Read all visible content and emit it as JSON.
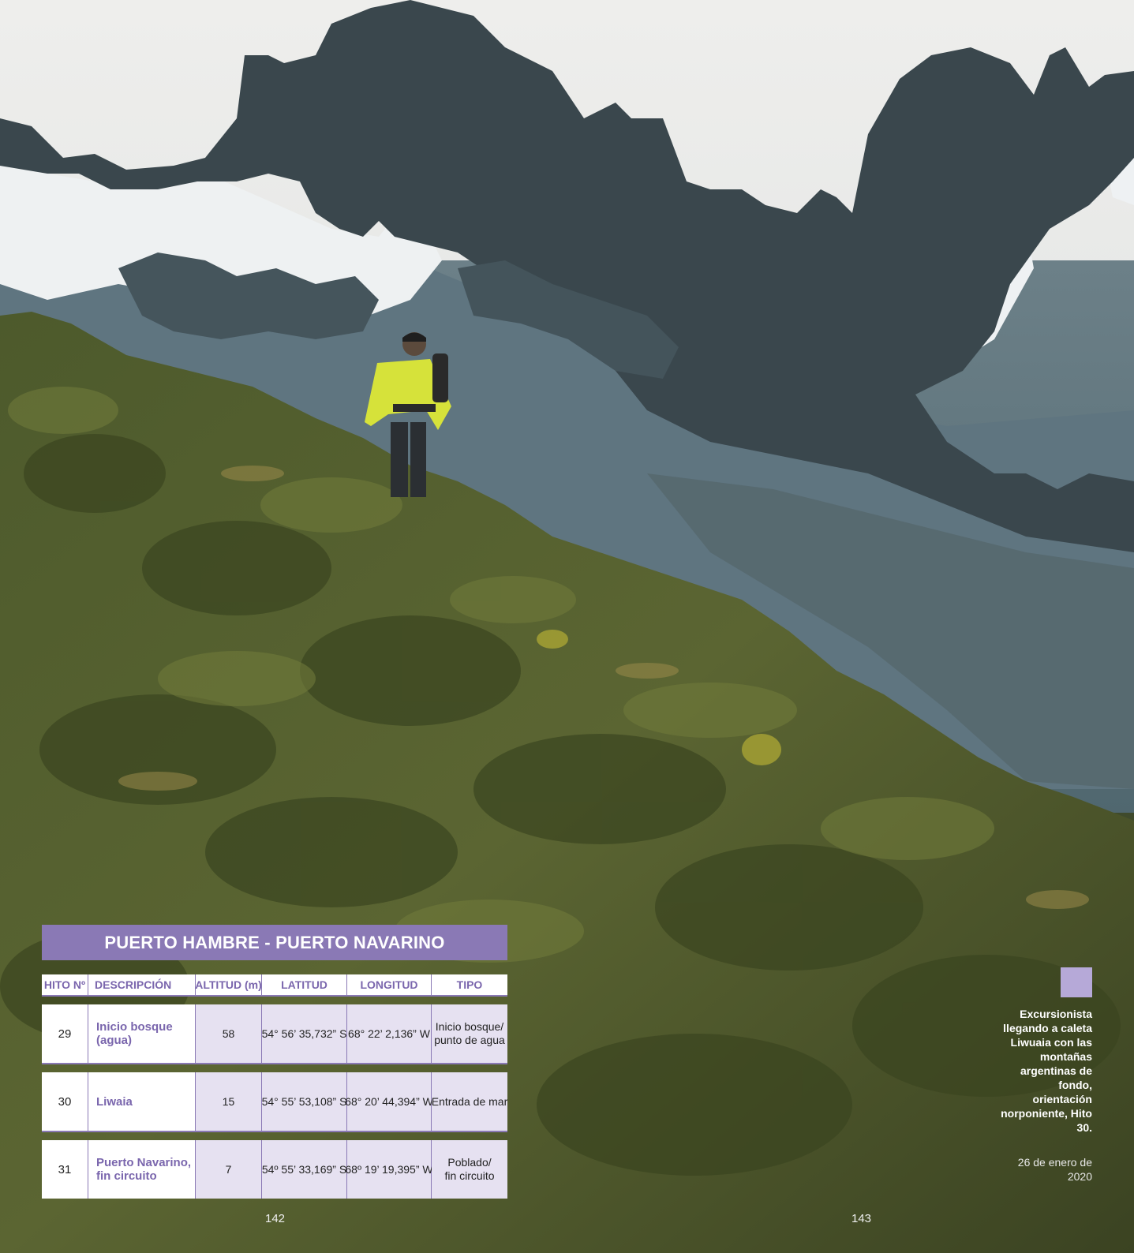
{
  "table": {
    "title": "PUERTO HAMBRE - PUERTO NAVARINO",
    "headers": [
      "HITO Nº",
      "DESCRIPCIÓN",
      "ALTITUD (m)",
      "LATITUD",
      "LONGITUD",
      "TIPO"
    ],
    "rows": [
      {
        "hito": "29",
        "descripcion": "Inicio bosque (agua)",
        "altitud": "58",
        "latitud": "54° 56’ 35,732” S",
        "longitud": "68° 22’ 2,136” W",
        "tipo_1": "Inicio bosque/",
        "tipo_2": "punto de agua"
      },
      {
        "hito": "30",
        "descripcion": "Liwaia",
        "altitud": "15",
        "latitud": "54° 55’ 53,108” S",
        "longitud": "68° 20’ 44,394” W",
        "tipo_1": "Entrada de mar",
        "tipo_2": ""
      },
      {
        "hito": "31",
        "descripcion": "Puerto Navarino, fin circuito",
        "altitud": "7",
        "latitud": "54º 55’ 33,169” S",
        "longitud": "68º 19’ 19,395” W",
        "tipo_1": "Poblado/",
        "tipo_2": "fin circuito"
      }
    ]
  },
  "caption": {
    "text": "Excursionista llegando a caleta Liwuaia con las montañas argentinas de fondo, orientación norponiente, Hito 30.",
    "date": "26 de enero de 2020"
  },
  "pages": {
    "left": "142",
    "right": "143"
  },
  "colors": {
    "accent": "#8a79b5",
    "accent_light": "#e6e1f1",
    "caption_square": "#b6a9d8"
  }
}
